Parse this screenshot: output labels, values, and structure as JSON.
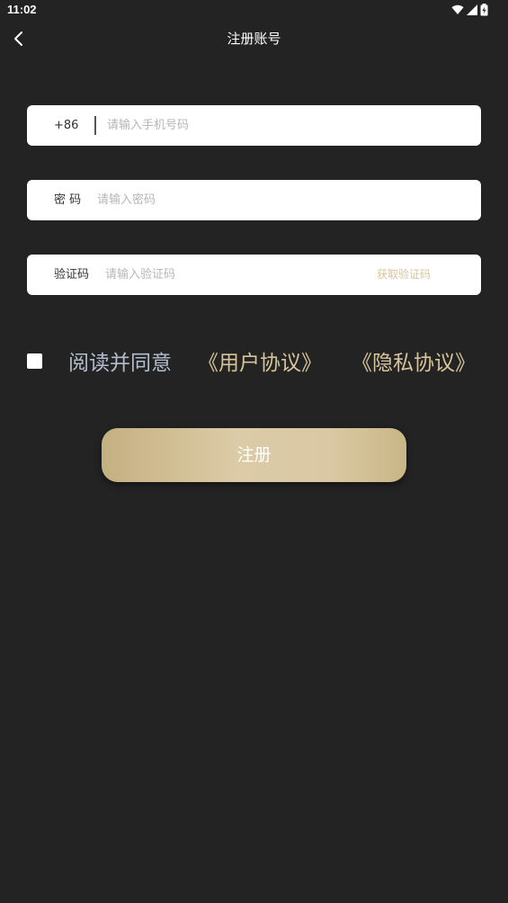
{
  "status_bar": {
    "time": "11:02",
    "icons": [
      "wifi-icon",
      "signal-icon",
      "battery-icon"
    ]
  },
  "header": {
    "title": "注册账号",
    "back_icon": "chevron-left-icon"
  },
  "form": {
    "phone": {
      "prefix": "+86",
      "value": "",
      "placeholder": "请输入手机号码"
    },
    "password": {
      "label": "密 码",
      "value": "",
      "placeholder": "请输入密码"
    },
    "code": {
      "label": "验证码",
      "value": "",
      "placeholder": "请输入验证码",
      "get_code_label": "获取验证码"
    }
  },
  "agreement": {
    "checked": false,
    "text": "阅读并同意",
    "user_agreement": "《用户协议》",
    "privacy_policy": "《隐私协议》"
  },
  "submit_label": "注册",
  "colors": {
    "background": "#232323",
    "accent_gold": "#d6c49a",
    "agree_text": "#b3bdcc",
    "placeholder": "#b6b6b6"
  }
}
